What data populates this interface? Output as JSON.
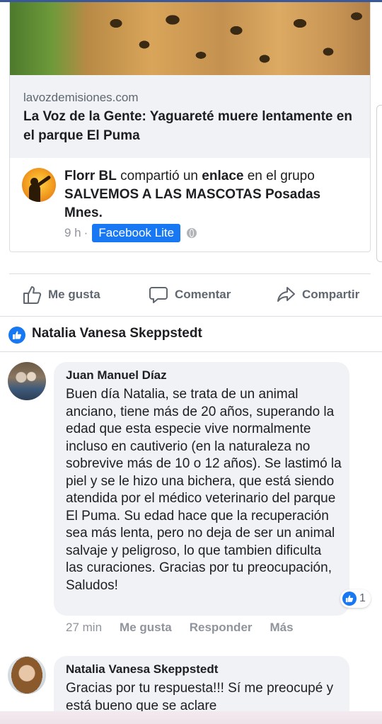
{
  "link_card": {
    "domain": "lavozdemisiones.com",
    "title": "La Voz de la Gente: Yaguareté muere lentamente en el parque El Puma"
  },
  "share": {
    "user": "Florr BL",
    "verb": " compartió un ",
    "object": "enlace",
    "connector": " en el grupo ",
    "group": "SALVEMOS A LAS MASCOTAS Posadas Mnes.",
    "time": "9 h",
    "separator": "·",
    "app_badge": "Facebook Lite",
    "privacy_icon": "globe-icon"
  },
  "actions": {
    "like": "Me gusta",
    "comment": "Comentar",
    "share": "Compartir"
  },
  "reactions": {
    "liker_name": "Natalia Vanesa Skeppstedt"
  },
  "comments": [
    {
      "author": "Juan Manuel Díaz",
      "text": "Buen día Natalia, se trata de un animal anciano, tiene más de 20 años, superando la edad que esta especie vive normalmente incluso en cautiverio (en la naturaleza no sobrevive más de 10 o 12 años). Se lastimó la piel y se le hizo una bichera, que está siendo atendida por el médico veterinario del parque El Puma. Su edad hace que la recuperación sea más lenta, pero no deja de ser un animal salvaje y peligroso, lo que tambien dificulta las curaciones. Gracias por tu preocupación, Saludos!",
      "reaction_count": "1",
      "time": "27 min",
      "like_label": "Me gusta",
      "reply_label": "Responder",
      "more_label": "Más"
    },
    {
      "author": "Natalia Vanesa Skeppstedt",
      "text": "Gracias por tu respuesta!!! Sí me preocupé y está bueno que se aclare"
    }
  ],
  "colors": {
    "brand_blue": "#1877f2",
    "bubble_bg": "#f0f2f5",
    "muted_text": "#606770"
  }
}
